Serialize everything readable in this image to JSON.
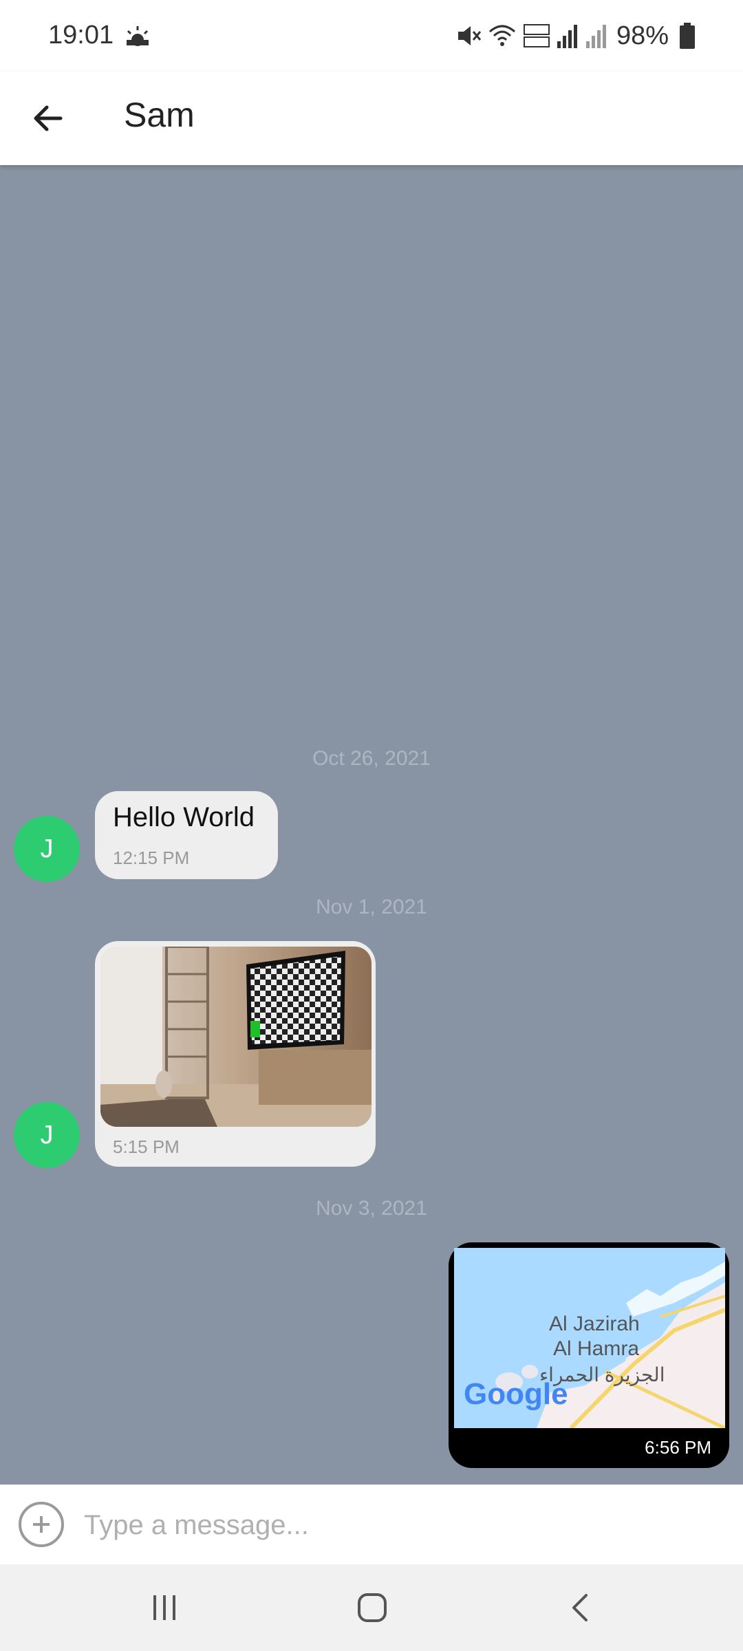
{
  "status_bar": {
    "time": "19:01",
    "battery": "98%",
    "icons": [
      "sunrise-weather-icon",
      "mute-icon",
      "wifi-icon",
      "volte-icon",
      "signal-icon",
      "roaming-signal-icon",
      "battery-icon"
    ]
  },
  "header": {
    "title": "Sam",
    "back_icon": "arrow-left-icon"
  },
  "messages": [
    {
      "date": "Oct 26, 2021",
      "sender_initial": "J",
      "direction": "incoming",
      "type": "text",
      "text": "Hello World",
      "time": "12:15 PM"
    },
    {
      "date": "Nov 1, 2021",
      "sender_initial": "J",
      "direction": "incoming",
      "type": "image",
      "time": "5:15 PM"
    },
    {
      "date": "Nov 3, 2021",
      "direction": "outgoing",
      "type": "location",
      "map_labels": [
        "Al Jazirah",
        "Al Hamra",
        "الجزيرة الحمراء"
      ],
      "map_logo": "Google",
      "time": "6:56 PM"
    }
  ],
  "input": {
    "placeholder": "Type a message...",
    "add_icon": "plus-circle-icon"
  },
  "nav": {
    "icons": [
      "recent-apps-icon",
      "home-icon",
      "back-nav-icon"
    ]
  },
  "colors": {
    "chat_background": "#8894a3",
    "avatar": "#2ecc71",
    "incoming_bubble": "#eeeeee",
    "outgoing_bubble": "#000000"
  }
}
